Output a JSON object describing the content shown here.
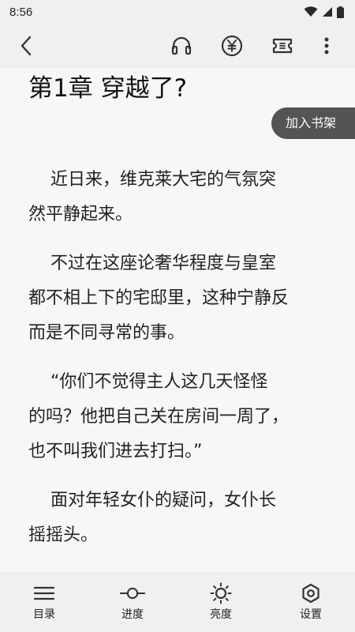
{
  "status_bar": {
    "time": "8:56",
    "icons": [
      "wifi-icon",
      "signal-icon",
      "battery-icon"
    ]
  },
  "toolbar": {
    "back_icon": "back-arrow-icon",
    "actions": [
      "headphones-icon",
      "yen-coin-icon",
      "ticket-icon",
      "more-vert-icon"
    ]
  },
  "reader": {
    "chapter_title": "第1章 穿越了?",
    "add_to_shelf": "加入书架",
    "lines": [
      "    近日来，维克莱大宅的气氛突",
      "然平静起来。",
      "    不过在这座论奢华程度与皇室",
      "都不相上下的宅邸里，这种宁静反",
      "而是不同寻常的事。",
      "    “你们不觉得主人这几天怪怪",
      "的吗？他把自己关在房间一周了，",
      "也不叫我们进去打扫。”",
      "    面对年轻女仆的疑问，女仆长",
      "摇摇头。"
    ]
  },
  "bottom_bar": {
    "items": [
      {
        "label": "目录",
        "icon": "menu-list-icon"
      },
      {
        "label": "进度",
        "icon": "progress-slider-icon"
      },
      {
        "label": "亮度",
        "icon": "brightness-sun-icon"
      },
      {
        "label": "设置",
        "icon": "settings-hexagon-icon"
      }
    ]
  },
  "colors": {
    "bar_background": "#f0f0f0",
    "page_background": "#f7f7f7",
    "shelf_button": "#545454",
    "text": "#222222"
  }
}
